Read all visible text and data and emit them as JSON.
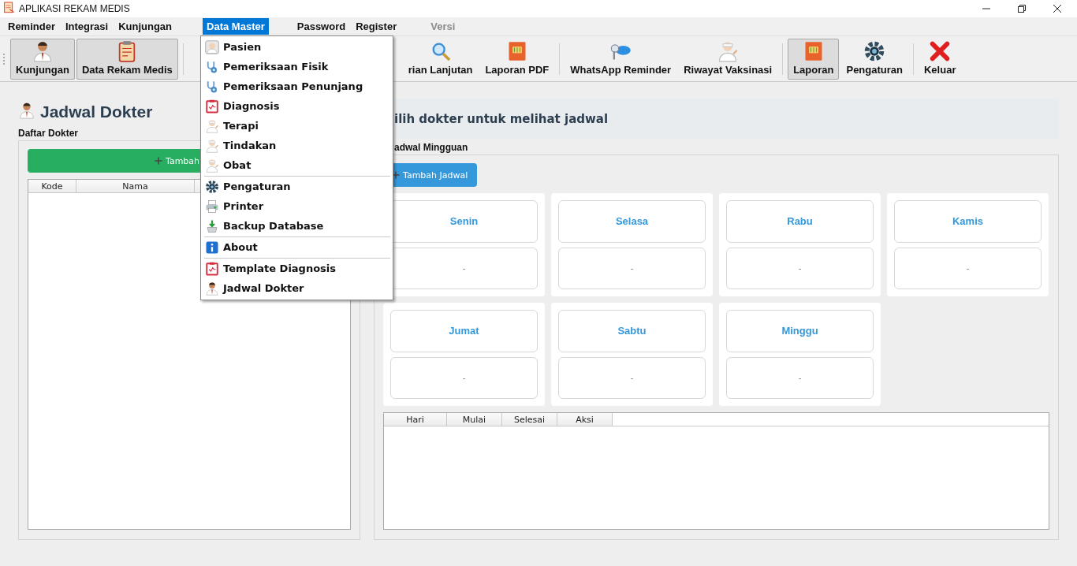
{
  "window": {
    "title": "APLIKASI REKAM MEDIS"
  },
  "menubar": [
    {
      "label": "Reminder",
      "selected": false,
      "disabled": false
    },
    {
      "label": "Integrasi",
      "selected": false,
      "disabled": false
    },
    {
      "label": "Kunjungan",
      "selected": false,
      "disabled": false
    },
    {
      "label": "Data Master",
      "selected": true,
      "disabled": false
    },
    {
      "label": "Password",
      "selected": false,
      "disabled": false
    },
    {
      "label": "Register",
      "selected": false,
      "disabled": false
    },
    {
      "label": "Versi",
      "selected": false,
      "disabled": true
    }
  ],
  "toolbar": [
    {
      "label": "Kunjungan",
      "pressed": true,
      "separator_after": false
    },
    {
      "label": "Data Rekam Medis",
      "pressed": true,
      "separator_after": true
    },
    {
      "label": "rian Lanjutan",
      "pressed": false,
      "separator_after": false
    },
    {
      "label": "Laporan PDF",
      "pressed": false,
      "separator_after": true
    },
    {
      "label": "WhatsApp Reminder",
      "pressed": false,
      "separator_after": false
    },
    {
      "label": "Riwayat Vaksinasi",
      "pressed": false,
      "separator_after": true
    },
    {
      "label": "Laporan",
      "pressed": true,
      "separator_after": false
    },
    {
      "label": "Pengaturan",
      "pressed": false,
      "separator_after": true
    },
    {
      "label": "Keluar",
      "pressed": false,
      "separator_after": false
    }
  ],
  "dropdown_menu": {
    "groups": [
      [
        {
          "label": "Pasien"
        },
        {
          "label": "Pemeriksaan Fisik"
        },
        {
          "label": "Pemeriksaan Penunjang"
        },
        {
          "label": "Diagnosis"
        },
        {
          "label": "Terapi"
        },
        {
          "label": "Tindakan"
        },
        {
          "label": "Obat"
        }
      ],
      [
        {
          "label": "Pengaturan"
        },
        {
          "label": "Printer"
        },
        {
          "label": "Backup Database"
        }
      ],
      [
        {
          "label": "About"
        }
      ],
      [
        {
          "label": "Template Diagnosis"
        },
        {
          "label": "Jadwal Dokter"
        }
      ]
    ]
  },
  "page_title": "Jadwal Dokter",
  "doctor_list": {
    "label": "Daftar Dokter",
    "add_button": "Tambah",
    "columns": [
      "Kode",
      "Nama"
    ]
  },
  "schedule": {
    "prompt": "ilih dokter untuk melihat jadwal",
    "label": "adwal Mingguan",
    "add_button": "Tambah Jadwal",
    "days": [
      {
        "name": "Senin",
        "value": "-"
      },
      {
        "name": "Selasa",
        "value": "-"
      },
      {
        "name": "Rabu",
        "value": "-"
      },
      {
        "name": "Kamis",
        "value": "-"
      },
      {
        "name": "Jumat",
        "value": "-"
      },
      {
        "name": "Sabtu",
        "value": "-"
      },
      {
        "name": "Minggu",
        "value": "-"
      }
    ],
    "columns": [
      "Hari",
      "Mulai",
      "Selesai",
      "Aksi"
    ]
  }
}
